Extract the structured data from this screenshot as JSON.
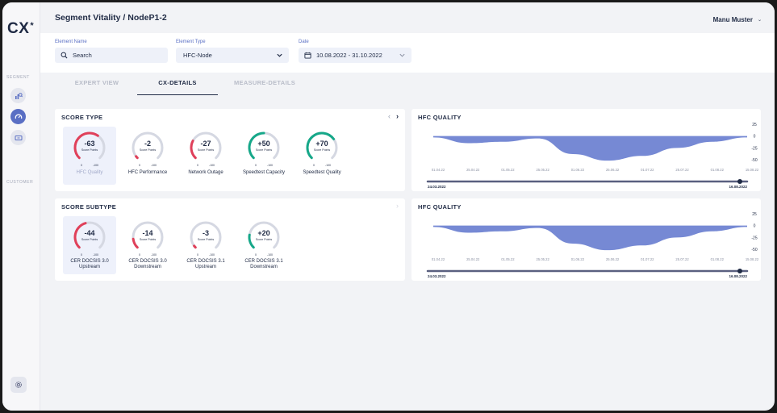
{
  "app": {
    "logo": "CX",
    "logo_star": "*"
  },
  "header": {
    "title": "Segment Vitality / NodeP1-2",
    "user": "Manu Muster",
    "user_chevron": "⌄"
  },
  "sidebar": {
    "section_segment": "SEGMENT",
    "section_customer": "CUSTOMER",
    "items": [
      {
        "name": "segment-analysis"
      },
      {
        "name": "segment-gauge",
        "active": true
      },
      {
        "name": "segment-ticket"
      }
    ]
  },
  "filters": {
    "element_name": {
      "label": "Element Name",
      "placeholder": "Search"
    },
    "element_type": {
      "label": "Element Type",
      "value": "HFC-Node"
    },
    "date": {
      "label": "Date",
      "value": "10.08.2022 - 31.10.2022"
    }
  },
  "tabs": [
    {
      "label": "EXPERT VIEW",
      "active": false
    },
    {
      "label": "CX-DETAILS",
      "active": true
    },
    {
      "label": "MEASURE-DETAILS",
      "active": false
    }
  ],
  "score_type": {
    "title": "SCORE TYPE",
    "prev_arrow": "‹",
    "next_arrow": "›",
    "gauges": [
      {
        "value": "-63",
        "unit": "Score Points",
        "min": "0",
        "max": "-100",
        "label": "HFC Quality",
        "color": "#e0405a",
        "level": 0.63
      },
      {
        "value": "-2",
        "unit": "Score Points",
        "min": "0",
        "max": "-100",
        "label": "HFC Performance",
        "color": "#e0405a",
        "level": 0.02
      },
      {
        "value": "-27",
        "unit": "Score Points",
        "min": "0",
        "max": "-100",
        "label": "Network Outage",
        "color": "#e0405a",
        "level": 0.27
      },
      {
        "value": "+50",
        "unit": "Score Points",
        "min": "0",
        "max": "-100",
        "label": "Speedtest Capacity",
        "color": "#16a889",
        "level": 0.5
      },
      {
        "value": "+70",
        "unit": "Score Points",
        "min": "0",
        "max": "-100",
        "label": "Speedtest Quality",
        "color": "#16a889",
        "level": 0.7
      }
    ]
  },
  "score_subtype": {
    "title": "SCORE SUBTYPE",
    "next_arrow": "›",
    "gauges": [
      {
        "value": "-44",
        "unit": "Score Points",
        "min": "0",
        "max": "-100",
        "label": "CER DOCSIS 3.0 Upstream",
        "color": "#e0405a",
        "level": 0.44
      },
      {
        "value": "-14",
        "unit": "Score Points",
        "min": "0",
        "max": "-100",
        "label": "CER DOCSIS 3.0 Downstream",
        "color": "#e0405a",
        "level": 0.14
      },
      {
        "value": "-3",
        "unit": "Score Points",
        "min": "0",
        "max": "-100",
        "label": "CER DOCSIS 3.1 Upstream",
        "color": "#e0405a",
        "level": 0.03
      },
      {
        "value": "+20",
        "unit": "Score Points",
        "min": "0",
        "max": "-100",
        "label": "CER DOCSIS 3.1 Downstream",
        "color": "#16a889",
        "level": 0.2
      }
    ]
  },
  "chart_data": [
    {
      "type": "area",
      "title": "HFC QUALITY",
      "x": [
        "01.04.22",
        "25.04.22",
        "01.05.22",
        "25.05.22",
        "01.06.22",
        "25.06.22",
        "01.07.22",
        "25.07.22",
        "01.08.22",
        "15.08.22"
      ],
      "ylim": [
        -50,
        25
      ],
      "yticks": [
        "25",
        "0",
        "-25",
        "-50"
      ],
      "series": [
        {
          "values": [
            -3,
            -15,
            -12,
            -5,
            -38,
            -52,
            -42,
            -25,
            -12,
            -3
          ]
        }
      ],
      "range": {
        "start": "24.03.2022",
        "end": "16.08.2022"
      },
      "color": "#6a7fd0"
    },
    {
      "type": "area",
      "title": "HFC QUALITY",
      "x": [
        "01.04.22",
        "25.04.22",
        "01.05.22",
        "25.05.22",
        "01.06.22",
        "25.06.22",
        "01.07.22",
        "25.07.22",
        "01.08.22",
        "15.08.22"
      ],
      "ylim": [
        -50,
        25
      ],
      "yticks": [
        "25",
        "0",
        "-25",
        "-50"
      ],
      "series": [
        {
          "values": [
            -3,
            -15,
            -12,
            -5,
            -38,
            -52,
            -42,
            -25,
            -12,
            -3
          ]
        }
      ],
      "range": {
        "start": "24.03.2022",
        "end": "16.08.2022"
      },
      "color": "#6a7fd0"
    }
  ]
}
